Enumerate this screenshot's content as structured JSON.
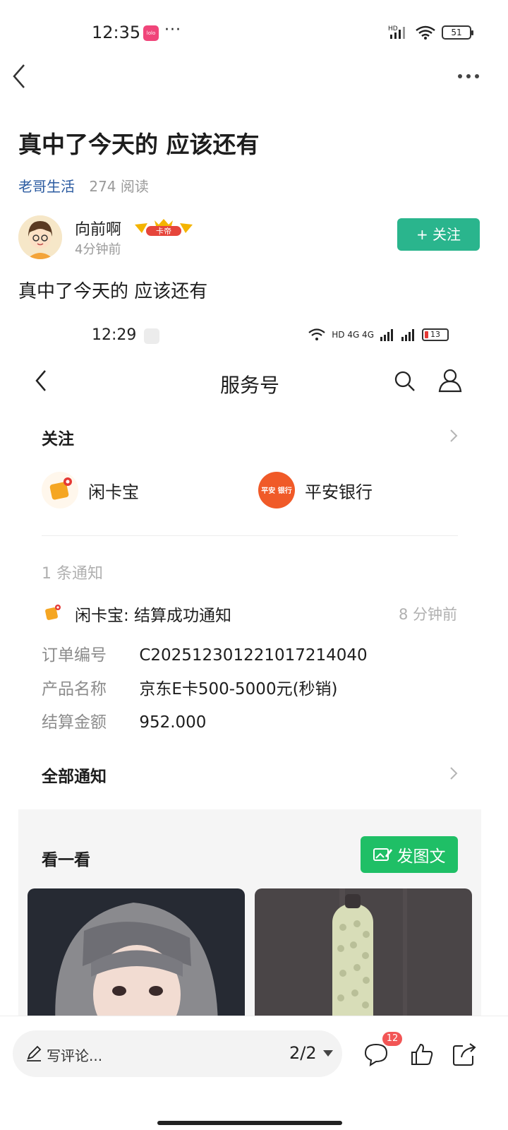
{
  "status_bar": {
    "time": "12:35",
    "app_icon_text": "lolo",
    "more": "···",
    "network": "HD",
    "battery": "51"
  },
  "article": {
    "title": "真中了今天的 应该还有",
    "circle": "老哥生活",
    "reads": "274 阅读",
    "body": "真中了今天的 应该还有"
  },
  "author": {
    "name": "向前啊",
    "badge": "卡帝",
    "time": "4分钟前",
    "follow_label": "+ 关注"
  },
  "embedded": {
    "status_time": "12:29",
    "status_network": "HD 4G 4G",
    "battery": "13",
    "title": "服务号",
    "follow_section": "关注",
    "accounts": [
      {
        "name": "闲卡宝",
        "icon": "xiankabao-icon"
      },
      {
        "name": "平安银行",
        "icon": "pingan-bank-icon",
        "logo_text": "平安 银行"
      }
    ],
    "notice_count": "1 条通知",
    "notice": {
      "title": "闲卡宝: 结算成功通知",
      "time": "8 分钟前",
      "rows": [
        {
          "key": "订单编号",
          "value": "C2025123012210172140​40"
        },
        {
          "key": "产品名称",
          "value": "京东E卡500-5000元(秒销)"
        },
        {
          "key": "结算金额",
          "value": "952.000"
        }
      ]
    },
    "all_notices": "全部通知",
    "look_title": "看一看",
    "post_button": "发图文"
  },
  "bottom_bar": {
    "comment_placeholder": "写评论...",
    "page": "2/2",
    "comment_count": "12"
  },
  "colors": {
    "follow_green": "#2ab58d",
    "post_green": "#1fbf66",
    "circle_link": "#2a5aa0",
    "badge_red": "#f25555"
  }
}
